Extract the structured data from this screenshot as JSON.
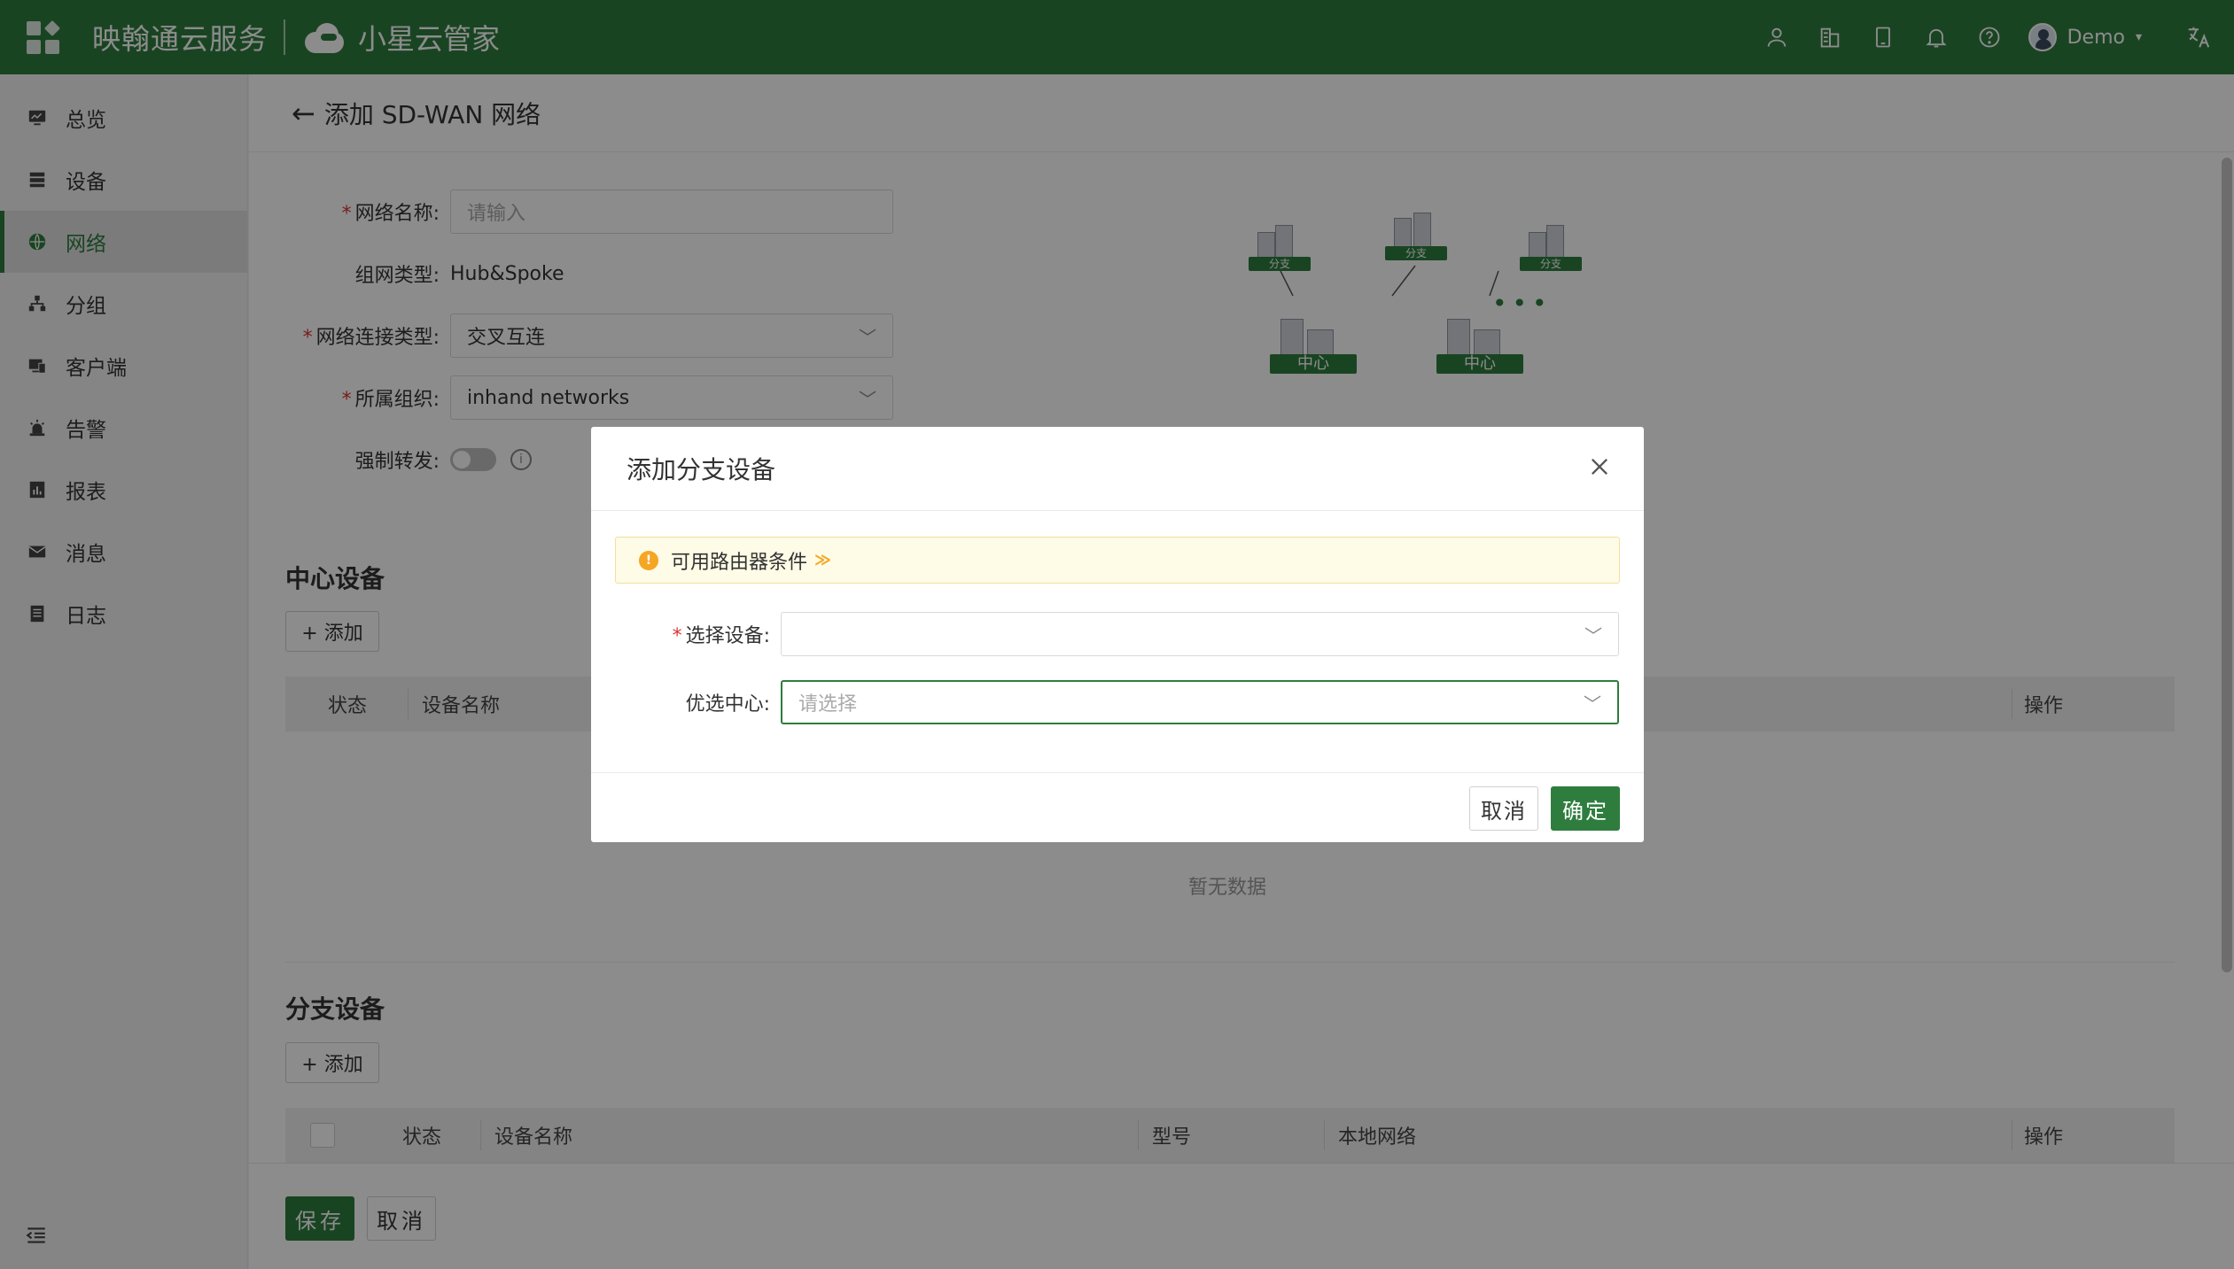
{
  "topbar": {
    "brand": "映翰通云服务",
    "product": "小星云管家",
    "username": "Demo",
    "icons": [
      "user-icon",
      "building-icon",
      "device-icon",
      "bell-icon",
      "help-icon",
      "translate-icon"
    ]
  },
  "sidebar": {
    "items": [
      {
        "label": "总览",
        "icon": "monitor-icon"
      },
      {
        "label": "设备",
        "icon": "server-icon"
      },
      {
        "label": "网络",
        "icon": "globe-icon",
        "active": true
      },
      {
        "label": "分组",
        "icon": "group-icon"
      },
      {
        "label": "客户端",
        "icon": "client-icon"
      },
      {
        "label": "告警",
        "icon": "alarm-icon"
      },
      {
        "label": "报表",
        "icon": "report-icon"
      },
      {
        "label": "消息",
        "icon": "mail-icon"
      },
      {
        "label": "日志",
        "icon": "log-icon"
      }
    ]
  },
  "page": {
    "title": "添加 SD-WAN 网络"
  },
  "form": {
    "network_name_label": "网络名称:",
    "network_name_placeholder": "请输入",
    "topology_label": "组网类型:",
    "topology_value": "Hub&Spoke",
    "conn_type_label": "网络连接类型:",
    "conn_type_value": "交叉互连",
    "org_label": "所属组织:",
    "org_value": "inhand networks",
    "force_label": "强制转发:"
  },
  "diagram": {
    "branch_label": "分支",
    "hub_label": "中心"
  },
  "hub_section": {
    "title": "中心设备",
    "add_label": "+ 添加",
    "columns": [
      "状态",
      "设备名称",
      "操作"
    ],
    "empty": "暂无数据"
  },
  "branch_section": {
    "title": "分支设备",
    "add_label": "+ 添加",
    "columns": [
      "状态",
      "设备名称",
      "型号",
      "本地网络",
      "操作"
    ]
  },
  "footer": {
    "save": "保存",
    "cancel": "取消"
  },
  "modal": {
    "title": "添加分支设备",
    "alert_text": "可用路由器条件",
    "select_device_label": "选择设备:",
    "select_device_value": "",
    "preferred_hub_label": "优选中心:",
    "preferred_hub_placeholder": "请选择",
    "cancel": "取消",
    "ok": "确定"
  },
  "colors": {
    "primary": "#2e7d3e",
    "warning": "#f5a623"
  }
}
